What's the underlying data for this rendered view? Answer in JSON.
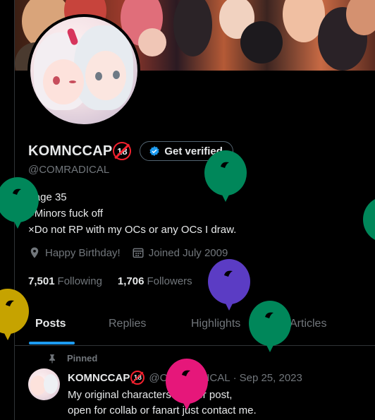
{
  "profile": {
    "display_name": "KOMNCCAP",
    "age_badge": "18",
    "verify_label": "Get verified",
    "handle": "@COMRADICAL",
    "bio": [
      "×age 35",
      "×Minors fuck off",
      "×Do not RP with my OCs or any OCs I draw."
    ],
    "location": "Happy Birthday!",
    "joined": "Joined July 2009",
    "following_count": "7,501",
    "following_label": "Following",
    "followers_count": "1,706",
    "followers_label": "Followers"
  },
  "tabs": [
    {
      "label": "Posts",
      "active": true
    },
    {
      "label": "Replies",
      "active": false
    },
    {
      "label": "Highlights",
      "active": false
    },
    {
      "label": "Articles",
      "active": false
    }
  ],
  "post": {
    "pinned_label": "Pinned",
    "author_name": "KOMNCCAP",
    "author_badge": "18",
    "author_handle": "@COMRADICAL",
    "separator": "·",
    "date": "Sep 25, 2023",
    "text": [
      "My original characters master post,",
      "open for collab or fanart just contact me."
    ]
  },
  "icons": {
    "verify": "verified-badge-icon",
    "location": "location-pin-icon",
    "calendar": "calendar-icon",
    "pin": "pin-icon",
    "balloon": "balloon-icon"
  },
  "colors": {
    "background": "#000000",
    "text_primary": "#e7e9ea",
    "text_secondary": "#71767b",
    "accent_blue": "#1d9bf0",
    "badge_red": "#f4212e",
    "balloon_green": "#00875a",
    "balloon_purple": "#5b3cc4",
    "balloon_yellow": "#c6a300",
    "balloon_pink": "#e6177a"
  }
}
